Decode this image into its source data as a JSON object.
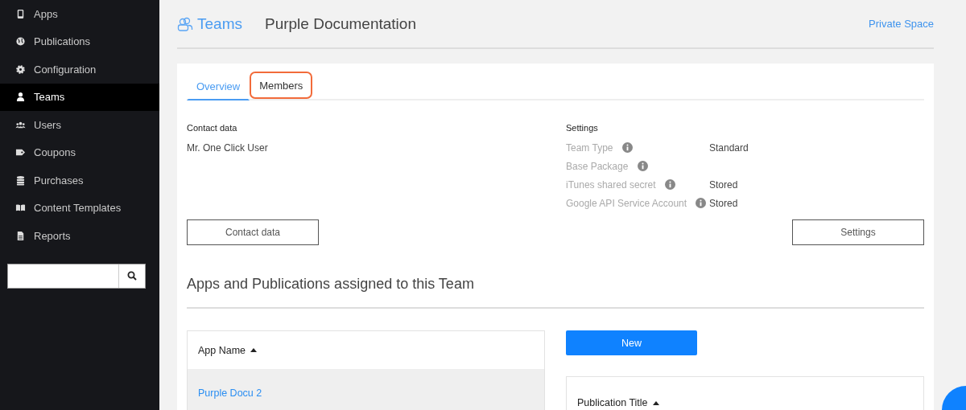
{
  "sidebar": {
    "items": [
      {
        "label": "Apps",
        "selected": false
      },
      {
        "label": "Publications",
        "selected": false
      },
      {
        "label": "Configuration",
        "selected": false
      },
      {
        "label": "Teams",
        "selected": true
      },
      {
        "label": "Users",
        "selected": false
      },
      {
        "label": "Coupons",
        "selected": false
      },
      {
        "label": "Purchases",
        "selected": false
      },
      {
        "label": "Content Templates",
        "selected": false
      },
      {
        "label": "Reports",
        "selected": false
      }
    ]
  },
  "header": {
    "section": "Teams",
    "title": "Purple Documentation",
    "link": "Private Space"
  },
  "tabs": [
    {
      "label": "Overview",
      "selected": true,
      "highlighted": false
    },
    {
      "label": "Members",
      "selected": false,
      "highlighted": true
    }
  ],
  "contact": {
    "heading": "Contact data",
    "name": "Mr. One Click User",
    "button": "Contact data"
  },
  "settings": {
    "heading": "Settings",
    "rows": [
      {
        "label": "Team Type",
        "value": "Standard"
      },
      {
        "label": "Base Package"
      },
      {
        "label": "iTunes shared secret",
        "value": "Stored"
      },
      {
        "label": "Google API Service Account",
        "value": "Stored"
      }
    ],
    "button": "Settings"
  },
  "assigned": {
    "title": "Apps and Publications assigned to this Team",
    "apps_table": {
      "column": "App Name",
      "rows": [
        "Purple Docu 2"
      ]
    },
    "new_button": "New",
    "publications_table": {
      "column": "Publication Title"
    }
  }
}
